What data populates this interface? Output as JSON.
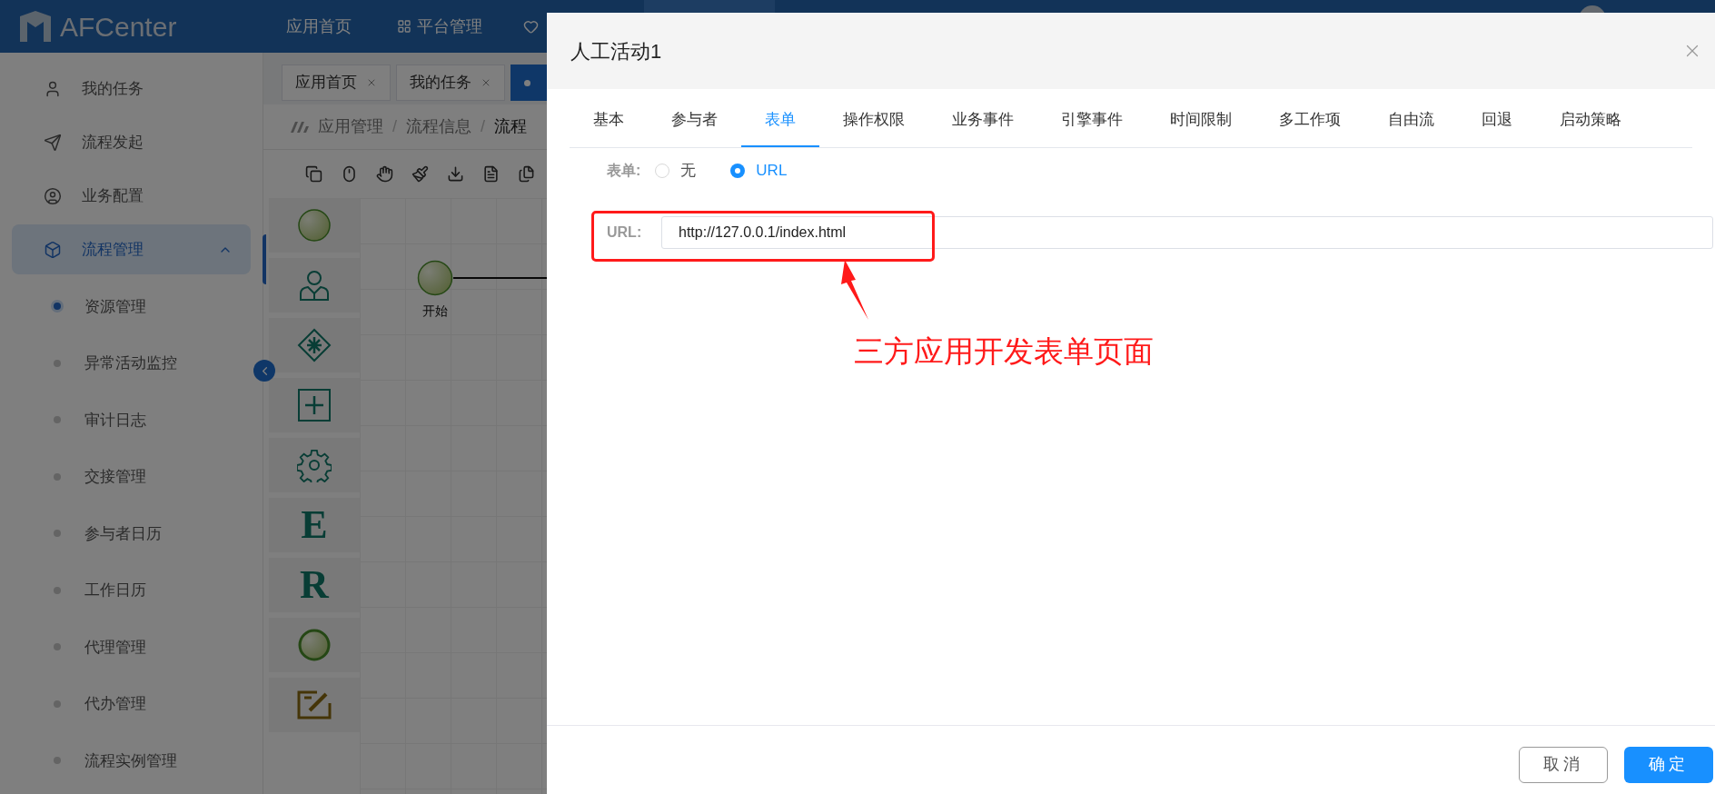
{
  "header": {
    "logo": "AFCenter",
    "nav": [
      {
        "label": "应用首页"
      },
      {
        "label": "平台管理"
      }
    ]
  },
  "sidebar": {
    "items": [
      {
        "label": "我的任务",
        "selected": false
      },
      {
        "label": "流程发起",
        "selected": false
      },
      {
        "label": "业务配置",
        "selected": false
      },
      {
        "label": "流程管理",
        "selected": true,
        "expanded": true,
        "children": [
          {
            "label": "资源管理",
            "selected": true
          },
          {
            "label": "异常活动监控",
            "selected": false
          },
          {
            "label": "审计日志",
            "selected": false
          },
          {
            "label": "交接管理",
            "selected": false
          },
          {
            "label": "参与者日历",
            "selected": false
          },
          {
            "label": "工作日历",
            "selected": false
          },
          {
            "label": "代理管理",
            "selected": false
          },
          {
            "label": "代办管理",
            "selected": false
          },
          {
            "label": "流程实例管理",
            "selected": false
          }
        ]
      }
    ]
  },
  "tabs": [
    {
      "label": "应用首页",
      "selected": false
    },
    {
      "label": "我的任务",
      "selected": false
    },
    {
      "selected": true
    }
  ],
  "breadcrumb": [
    {
      "kind": "link",
      "text": "应用管理"
    },
    {
      "kind": "separator",
      "text": "/"
    },
    {
      "kind": "link",
      "text": "流程信息"
    },
    {
      "kind": "separator",
      "text": "/"
    },
    {
      "kind": "current",
      "text": "流程"
    }
  ],
  "palette": [
    {
      "kind": "start"
    },
    {
      "kind": "person"
    },
    {
      "kind": "gateway"
    },
    {
      "kind": "subprocess"
    },
    {
      "kind": "service"
    },
    {
      "kind": "letter",
      "text": "E"
    },
    {
      "kind": "letter",
      "text": "R"
    },
    {
      "kind": "end"
    },
    {
      "kind": "form"
    }
  ],
  "canvas": {
    "start_label": "开始"
  },
  "dialog": {
    "title": "人工活动1",
    "tabs": [
      {
        "label": "基本",
        "selected": false
      },
      {
        "label": "参与者",
        "selected": false
      },
      {
        "label": "表单",
        "selected": true
      },
      {
        "label": "操作权限",
        "selected": false
      },
      {
        "label": "业务事件",
        "selected": false
      },
      {
        "label": "引擎事件",
        "selected": false
      },
      {
        "label": "时间限制",
        "selected": false
      },
      {
        "label": "多工作项",
        "selected": false
      },
      {
        "label": "自由流",
        "selected": false
      },
      {
        "label": "回退",
        "selected": false
      },
      {
        "label": "启动策略",
        "selected": false
      }
    ],
    "form_type": {
      "label": "表单:",
      "options": [
        {
          "label": "无",
          "selected": false
        },
        {
          "label": "URL",
          "selected": true
        }
      ]
    },
    "url": {
      "label": "URL:",
      "value": "http://127.0.0.1/index.html"
    },
    "annotation": "三方应用开发表单页面",
    "buttons": [
      {
        "label": "取消",
        "kind": "secondary"
      },
      {
        "label": "确定",
        "kind": "primary"
      }
    ]
  }
}
